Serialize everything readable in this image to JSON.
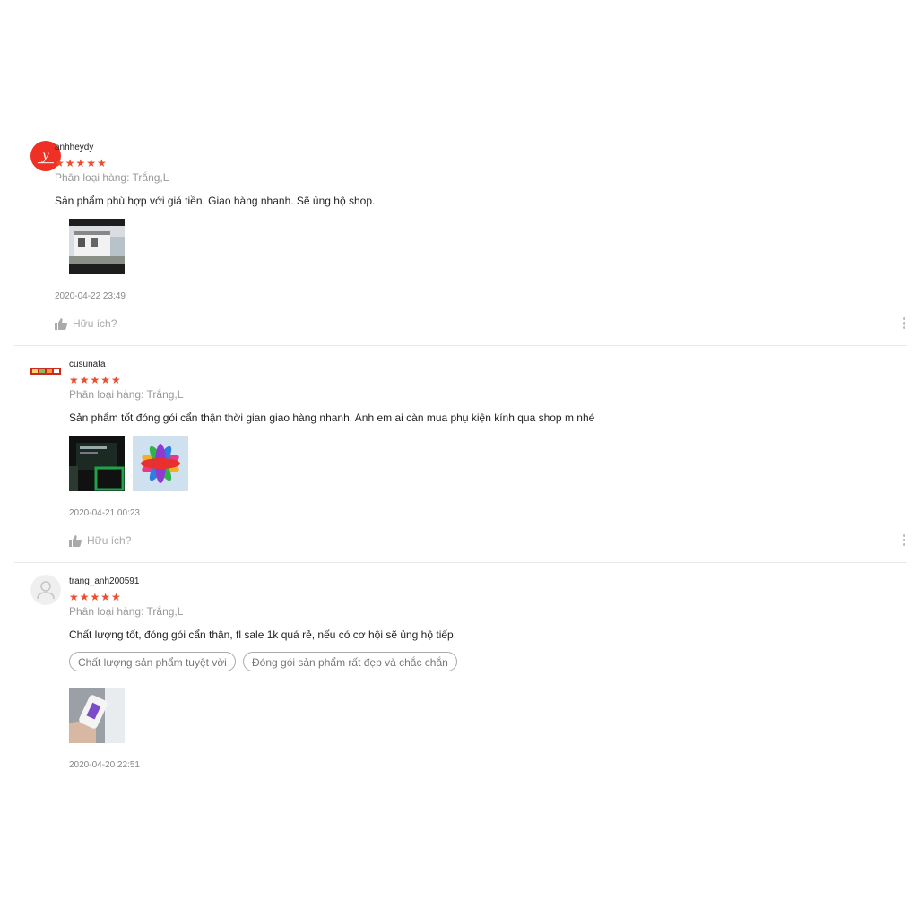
{
  "reviews": [
    {
      "username": "anhheydy",
      "rating": 5,
      "stars": "★★★★★",
      "variation": "Phân loại hàng: Trắng,L",
      "comment": "Sản phẩm phù hợp với giá tiền. Giao hàng nhanh. Sẽ ủng hộ shop.",
      "avatar_letter": "y",
      "time": "2020-04-22 23:49",
      "helpful": "Hữu ích?"
    },
    {
      "username": "cusunata",
      "rating": 5,
      "stars": "★★★★★",
      "variation": "Phân loại hàng: Trắng,L",
      "comment": "Sản phẩm tốt đóng gói cẩn thận thời gian giao hàng nhanh. Anh em ai càn mua phụ kiện kính qua shop m nhé",
      "time": "2020-04-21 00:23",
      "helpful": "Hữu ích?"
    },
    {
      "username": "trang_anh200591",
      "rating": 5,
      "stars": "★★★★★",
      "variation": "Phân loại hàng: Trắng,L",
      "comment": "Chất lượng tốt, đóng gói cẩn thận, fl sale 1k quá rẻ, nếu có cơ hội sẽ ủng hộ tiếp",
      "tags": [
        "Chất lượng sản phẩm tuyệt vời",
        "Đóng gói sản phẩm rất đẹp và chắc chắn"
      ],
      "time": "2020-04-20 22:51"
    }
  ],
  "colors": {
    "accent": "#ee4d2d",
    "muted": "#999999",
    "divider": "#e8e8e8"
  }
}
